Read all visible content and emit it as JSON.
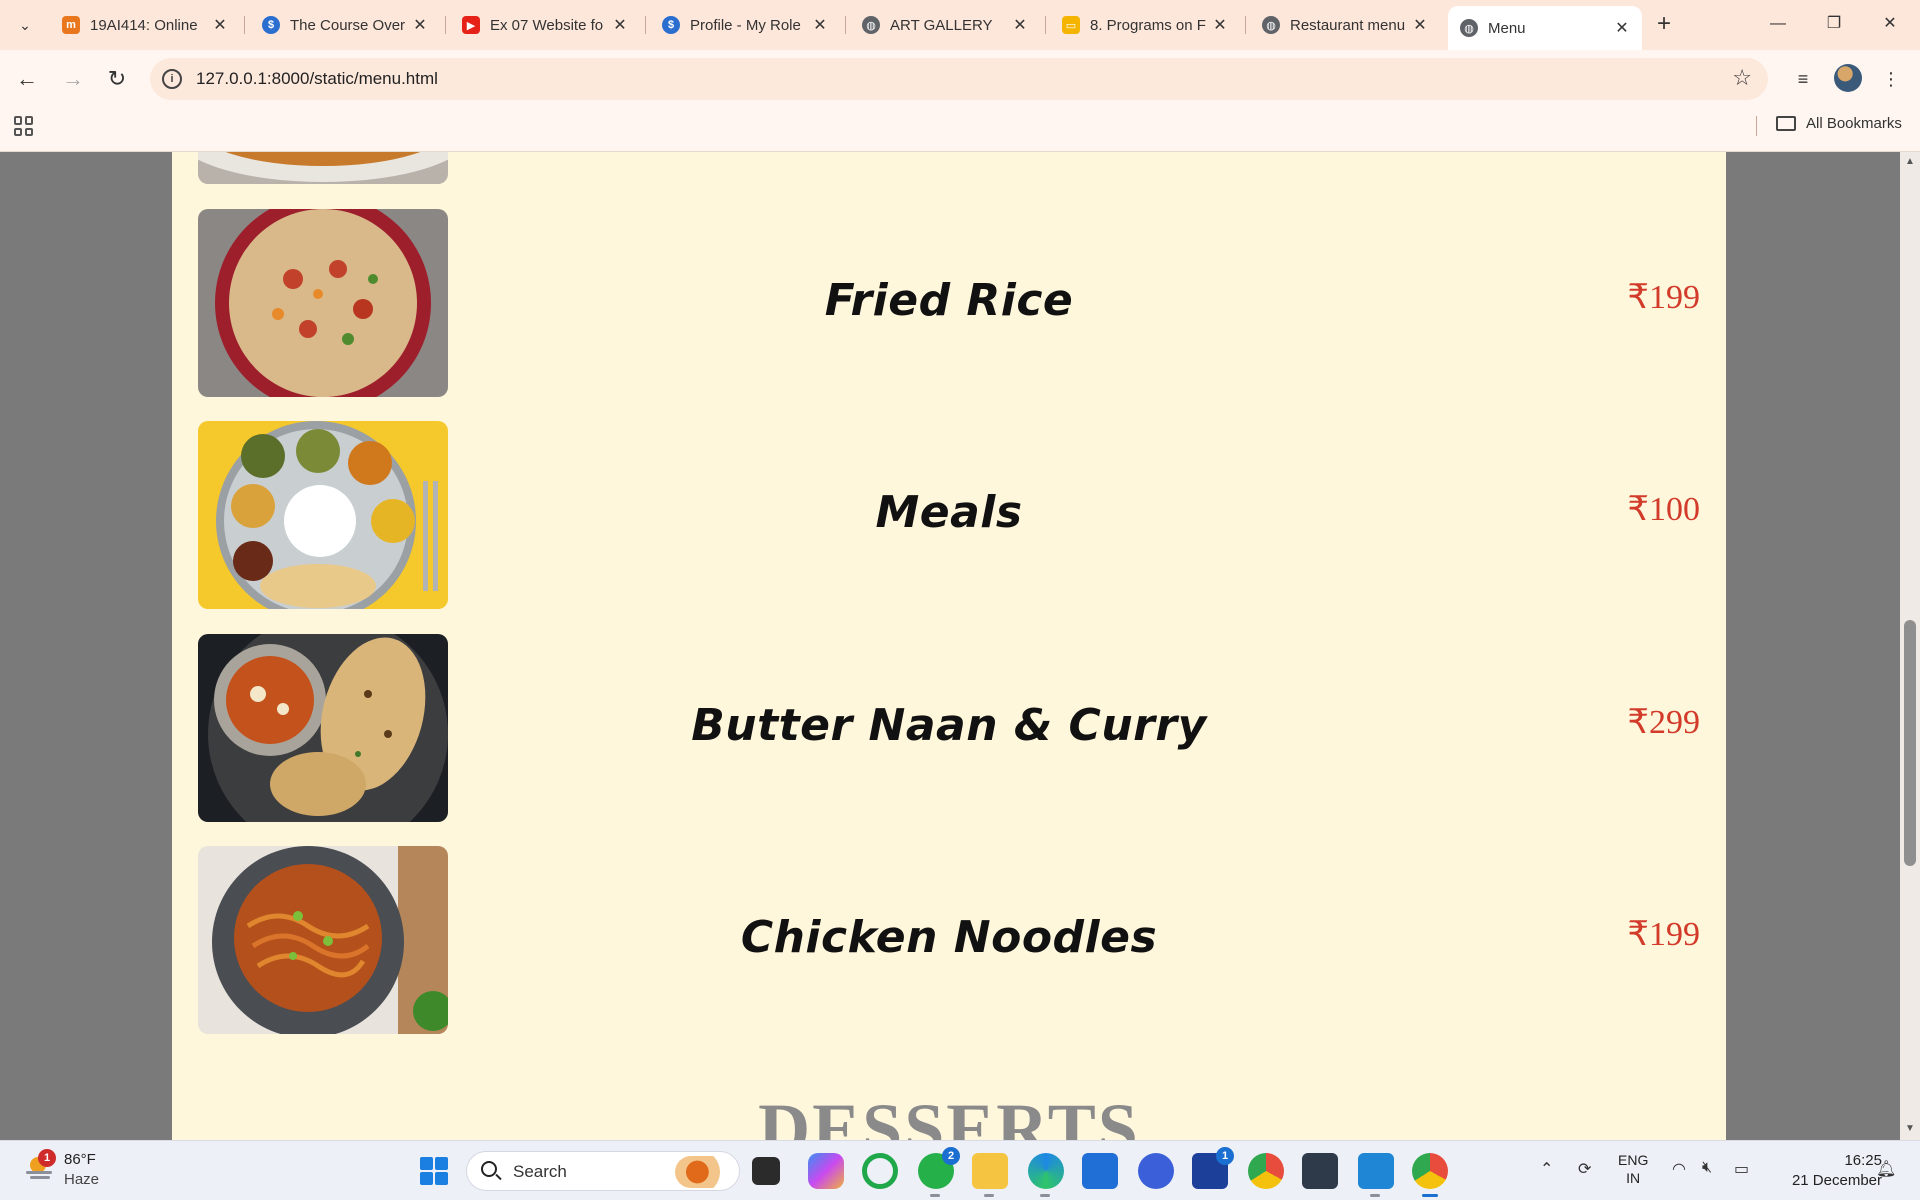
{
  "browser": {
    "tabs": [
      {
        "title": "19AI414: Online",
        "icon": "moodle-icon",
        "color": "#e8771e"
      },
      {
        "title": "The Course Over",
        "icon": "course-icon",
        "color": "#2a6fd0"
      },
      {
        "title": "Ex 07 Website fo",
        "icon": "youtube-icon",
        "color": "#e62117"
      },
      {
        "title": "Profile - My Role",
        "icon": "profile-site-icon",
        "color": "#2a6fd0"
      },
      {
        "title": "ART GALLERY",
        "icon": "globe-icon",
        "color": "#5f6368"
      },
      {
        "title": "8. Programs on F",
        "icon": "slides-icon",
        "color": "#f4b400"
      },
      {
        "title": "Restaurant menu",
        "icon": "globe-icon",
        "color": "#5f6368"
      },
      {
        "title": "Menu",
        "icon": "globe-icon",
        "color": "#5f6368",
        "active": true
      }
    ],
    "url": "127.0.0.1:8000/static/menu.html",
    "bookmarks_label": "All Bookmarks"
  },
  "menu": {
    "items": [
      {
        "name": "Fried Rice",
        "price": "₹199",
        "image": "fried-rice-photo"
      },
      {
        "name": "Meals",
        "price": "₹100",
        "image": "meals-thali-photo"
      },
      {
        "name": "Butter Naan & Curry",
        "price": "₹299",
        "image": "butter-naan-curry-photo"
      },
      {
        "name": "Chicken Noodles",
        "price": "₹199",
        "image": "chicken-noodles-photo"
      }
    ],
    "next_section": "DESSERTS",
    "price_color": "#d23a2a",
    "background_color": "#fff7dc"
  },
  "taskbar": {
    "weather": {
      "badge": "1",
      "temperature": "86°F",
      "condition": "Haze"
    },
    "search_label": "Search",
    "apps": [
      {
        "name": "task-view",
        "badge": ""
      },
      {
        "name": "copilot",
        "badge": ""
      },
      {
        "name": "green-circle-app",
        "badge": ""
      },
      {
        "name": "whatsapp",
        "badge": "2"
      },
      {
        "name": "file-explorer",
        "badge": ""
      },
      {
        "name": "edge",
        "badge": ""
      },
      {
        "name": "microsoft-store",
        "badge": ""
      },
      {
        "name": "arc-app",
        "badge": ""
      },
      {
        "name": "l-app",
        "badge": "1"
      },
      {
        "name": "chrome",
        "badge": ""
      },
      {
        "name": "calculator-app",
        "badge": ""
      },
      {
        "name": "vscode",
        "badge": ""
      },
      {
        "name": "chrome-active",
        "badge": ""
      }
    ],
    "language": {
      "line1": "ENG",
      "line2": "IN"
    },
    "time": "16:25",
    "date": "21 December"
  }
}
